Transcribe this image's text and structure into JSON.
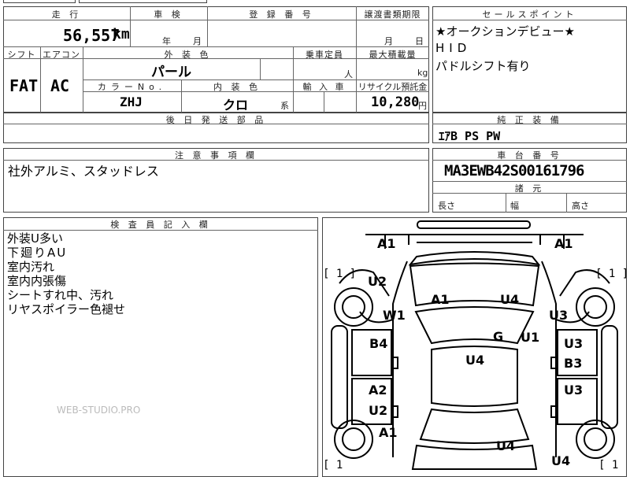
{
  "header": {
    "distance_label": "走 行",
    "inspection_label": "車 検",
    "registration_label": "登 録 番 号",
    "transfer_label": "譲渡書類期限",
    "selling_points_label": "セールスポイント",
    "mileage": "56,557",
    "mileage_unit": "km",
    "year_unit": "年",
    "month_unit": "月",
    "transfer_month": "月",
    "transfer_day": "日"
  },
  "vehicle": {
    "shift_label": "シフト",
    "aircon_label": "エアコン",
    "exterior_color_label": "外 装 色",
    "capacity_label": "乗車定員",
    "max_load_label": "最大積載量",
    "shift": "FAT",
    "aircon": "AC",
    "exterior_color": "パール",
    "capacity_unit": "人",
    "load_unit": "kg",
    "color_no_label": "カラーNo.",
    "interior_color_label": "内 装 色",
    "import_label": "輸 入 車",
    "recycle_label": "リサイクル預託金",
    "color_no": "ZHJ",
    "interior_color": "クロ",
    "interior_suffix": "系",
    "recycle_fee": "10,280",
    "recycle_unit": "円"
  },
  "selling_points": [
    "★オークションデビュー★",
    "HID",
    "パドルシフト有り"
  ],
  "post_parts_label": "後 日 発 送 部 品",
  "standard_equipment_label": "純 正 装 備",
  "standard_equipment": "ｴｱB PS PW",
  "notes_label": "注 意 事 項 欄",
  "notes": "社外アルミ、スタッドレス",
  "chassis_label": "車 台 番 号",
  "chassis_number": "MA3EWB42S00161796",
  "dimensions_label": "諸 元",
  "length_label": "長さ",
  "width_label": "幅",
  "height_label": "高さ",
  "inspector_label": "検 査 員 記 入 欄",
  "inspector_notes": [
    "外装U多い",
    "下廻りAU",
    "室内汚れ",
    "室内内張傷",
    "シートすれ中、汚れ",
    "リヤスポイラー色褪せ"
  ],
  "watermark": "WEB-STUDIO.PRO",
  "diagram": {
    "marks": [
      "A1",
      "A1",
      "U2",
      "A1",
      "U4",
      "W1",
      "U3",
      "B4",
      "G",
      "U1",
      "U3",
      "U4",
      "B3",
      "A2",
      "U3",
      "U2",
      "A1",
      "U4",
      "U4"
    ],
    "brackets": [
      "[ 1 ]",
      "[ 1 ]",
      "[ 1",
      "[ 1"
    ]
  }
}
